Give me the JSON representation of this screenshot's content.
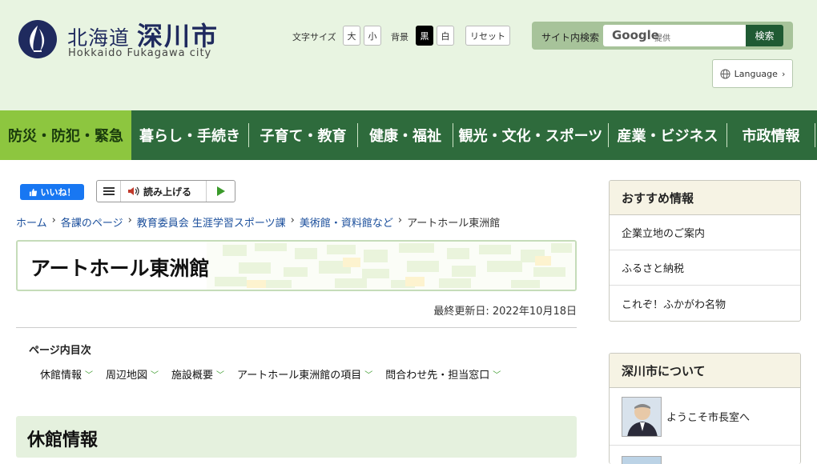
{
  "header": {
    "logo_jp_prefix": "北海道",
    "logo_jp_city": "深川市",
    "logo_en": "Hokkaido Fukagawa city",
    "font_size_label": "文字サイズ",
    "font_large": "大",
    "font_small": "小",
    "bg_label": "背景",
    "bg_black": "黒",
    "bg_white": "白",
    "reset": "リセット",
    "search_label": "サイト内検索",
    "search_placeholder_brand": "Google",
    "search_placeholder_sub": "提供",
    "search_button": "検索",
    "language": "Language"
  },
  "nav": {
    "items": [
      {
        "label": "防災・防犯・緊急",
        "active": true
      },
      {
        "label": "暮らし・手続き"
      },
      {
        "label": "子育て・教育"
      },
      {
        "label": "健康・福祉"
      },
      {
        "label": "観光・文化・スポーツ"
      },
      {
        "label": "産業・ビジネス"
      },
      {
        "label": "市政情報"
      }
    ]
  },
  "share": {
    "like": "いいね！",
    "reader": "読み上げる"
  },
  "breadcrumb": {
    "items": [
      "ホーム",
      "各課のページ",
      "教育委員会 生涯学習スポーツ課",
      "美術館・資料館など"
    ],
    "current": "アートホール東洲館"
  },
  "page": {
    "title": "アートホール東洲館",
    "updated": "最終更新日: 2022年10月18日",
    "toc_title": "ページ内目次",
    "toc": [
      "休館情報",
      "周辺地図",
      "施設概要",
      "アートホール東洲館の項目",
      "問合わせ先・担当窓口"
    ],
    "section_title": "休館情報"
  },
  "sidebar": {
    "recommended": {
      "title": "おすすめ情報",
      "items": [
        "企業立地のご案内",
        "ふるさと納税",
        "これぞ！ふかがわ名物"
      ]
    },
    "about": {
      "title": "深川市について",
      "items": [
        "ようこそ市長室へ"
      ]
    }
  },
  "colors": {
    "header_bg": "#e8f4e1",
    "nav_bg": "#2e6b3c",
    "nav_active": "#8dc63f",
    "logo_blue": "#1f2a5e",
    "link": "#1b4f9c"
  }
}
